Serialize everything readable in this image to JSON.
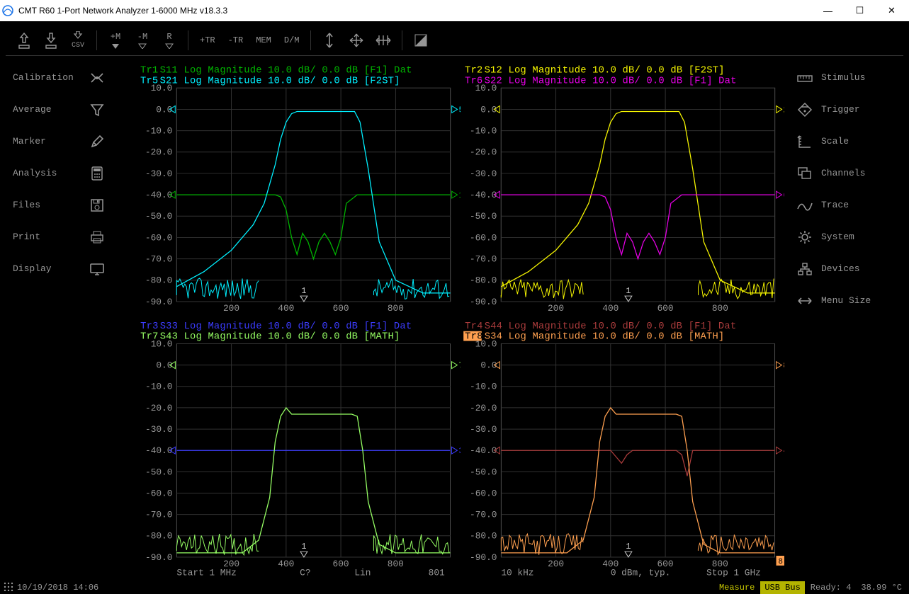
{
  "title": "CMT  R60 1-Port Network Analyzer  1-6000 MHz  v18.3.3",
  "window": {
    "minimize": "—",
    "maximize": "☐",
    "close": "✕"
  },
  "toolbar": {
    "home": "⌂",
    "save": "💾",
    "csv": "CSV",
    "plusM": "+M",
    "minusM": "-M",
    "R": "R",
    "plusTR": "+TR",
    "minusTR": "-TR",
    "MEM": "MEM",
    "DM": "D/M"
  },
  "left_menu": [
    {
      "label": "Calibration",
      "icon": "cal"
    },
    {
      "label": "Average",
      "icon": "funnel"
    },
    {
      "label": "Marker",
      "icon": "pencil"
    },
    {
      "label": "Analysis",
      "icon": "calc"
    },
    {
      "label": "Files",
      "icon": "disk"
    },
    {
      "label": "Print",
      "icon": "printer"
    },
    {
      "label": "Display",
      "icon": "monitor"
    }
  ],
  "right_menu": [
    {
      "label": "Stimulus",
      "icon": "ruler"
    },
    {
      "label": "Trigger",
      "icon": "diamond"
    },
    {
      "label": "Scale",
      "icon": "scale"
    },
    {
      "label": "Channels",
      "icon": "channels"
    },
    {
      "label": "Trace",
      "icon": "trace"
    },
    {
      "label": "System",
      "icon": "gear"
    },
    {
      "label": "Devices",
      "icon": "tree"
    },
    {
      "label": "Menu Size",
      "icon": "resize"
    }
  ],
  "status": {
    "datetime": "10/19/2018 14:06",
    "measure": "Measure",
    "usb": "USB Bus",
    "ready": "Ready: 4",
    "temp": "38.99 °C",
    "start": "Start 1 MHz",
    "c": "C?",
    "lin": "Lin",
    "points": "801",
    "if": "10 kHz",
    "pow": "0 dBm, typ.",
    "stop": "Stop 1 GHz"
  },
  "chart_data": [
    {
      "type": "line",
      "title": "",
      "panel": 1,
      "xlabel": "MHz",
      "ylabel": "dB",
      "ylim": [
        -90,
        10
      ],
      "xlim": [
        0,
        1000
      ],
      "xticks": [
        200,
        400,
        600,
        800
      ],
      "yticks": [
        10,
        0,
        -10,
        -20,
        -30,
        -40,
        -50,
        -60,
        -70,
        -80,
        -90
      ],
      "markers": [
        {
          "id": 1,
          "x": 465
        }
      ],
      "series": [
        {
          "name": "Tr1",
          "label": "Tr1 S11 Log Magnitude 10.0 dB/ 0.0 dB  [F1]   Dat",
          "color": "#00b400",
          "ref": -40,
          "ref_marker": 1,
          "x": [
            0,
            100,
            200,
            280,
            320,
            360,
            380,
            400,
            420,
            440,
            460,
            480,
            500,
            520,
            540,
            560,
            580,
            600,
            620,
            660,
            700,
            800,
            900,
            1000
          ],
          "y": [
            -40,
            -40,
            -40,
            -40,
            -40,
            -40,
            -41,
            -47,
            -60,
            -68,
            -58,
            -62,
            -70,
            -62,
            -58,
            -62,
            -68,
            -60,
            -44,
            -40,
            -40,
            -40,
            -40,
            -40
          ]
        },
        {
          "name": "Tr5",
          "label": "Tr5 S21 Log Magnitude 10.0 dB/ 0.0 dB  [F2ST]",
          "color": "#00f0ff",
          "ref": 0,
          "ref_marker": 5,
          "x": [
            0,
            100,
            200,
            280,
            320,
            360,
            380,
            400,
            420,
            440,
            460,
            650,
            670,
            700,
            740,
            800,
            900,
            1000
          ],
          "y": [
            -83,
            -76,
            -66,
            -54,
            -44,
            -26,
            -14,
            -6,
            -2,
            -1,
            -1,
            -1,
            -6,
            -28,
            -62,
            -80,
            -86,
            -86
          ]
        }
      ]
    },
    {
      "type": "line",
      "panel": 2,
      "xlabel": "MHz",
      "ylabel": "dB",
      "ylim": [
        -90,
        10
      ],
      "xlim": [
        0,
        1000
      ],
      "xticks": [
        200,
        400,
        600,
        800
      ],
      "yticks": [
        10,
        0,
        -10,
        -20,
        -30,
        -40,
        -50,
        -60,
        -70,
        -80,
        -90
      ],
      "markers": [
        {
          "id": 1,
          "x": 465
        }
      ],
      "series": [
        {
          "name": "Tr2",
          "label": "Tr2 S12 Log Magnitude 10.0 dB/ 0.0 dB  [F2ST]",
          "color": "#f5f500",
          "ref": 0,
          "ref_marker": 2,
          "x": [
            0,
            100,
            200,
            280,
            320,
            360,
            380,
            400,
            420,
            440,
            460,
            650,
            670,
            700,
            740,
            800,
            900,
            1000
          ],
          "y": [
            -83,
            -76,
            -66,
            -54,
            -44,
            -26,
            -14,
            -6,
            -2,
            -1,
            -1,
            -1,
            -6,
            -28,
            -62,
            -80,
            -86,
            -86
          ]
        },
        {
          "name": "Tr6",
          "label": "Tr6 S22 Log Magnitude 10.0 dB/ 0.0 dB  [F1]   Dat",
          "color": "#e600e6",
          "ref": -40,
          "ref_marker": 6,
          "x": [
            0,
            100,
            200,
            280,
            320,
            360,
            380,
            400,
            420,
            440,
            460,
            480,
            500,
            520,
            540,
            560,
            580,
            600,
            620,
            660,
            700,
            800,
            900,
            1000
          ],
          "y": [
            -40,
            -40,
            -40,
            -40,
            -40,
            -40,
            -41,
            -47,
            -60,
            -68,
            -58,
            -62,
            -70,
            -62,
            -58,
            -62,
            -68,
            -60,
            -44,
            -40,
            -40,
            -40,
            -40,
            -40
          ]
        }
      ]
    },
    {
      "type": "line",
      "panel": 3,
      "xlabel": "MHz",
      "ylabel": "dB",
      "ylim": [
        -90,
        10
      ],
      "xlim": [
        0,
        1000
      ],
      "xticks": [
        200,
        400,
        600,
        800
      ],
      "yticks": [
        10,
        0,
        -10,
        -20,
        -30,
        -40,
        -50,
        -60,
        -70,
        -80,
        -90
      ],
      "markers": [
        {
          "id": 1,
          "x": 465
        }
      ],
      "series": [
        {
          "name": "Tr3",
          "label": "Tr3 S33 Log Magnitude 10.0 dB/ 0.0 dB  [F1]   Dat",
          "color": "#3c3cff",
          "ref": -40,
          "ref_marker": 3,
          "x": [
            0,
            1000
          ],
          "y": [
            -40,
            -40
          ]
        },
        {
          "name": "Tr7",
          "label": "Tr7 S43 Log Magnitude 10.0 dB/ 0.0 dB  [MATH]",
          "color": "#96ff64",
          "ref": 0,
          "ref_marker": 7,
          "x": [
            0,
            240,
            300,
            340,
            360,
            380,
            400,
            420,
            640,
            660,
            680,
            700,
            740,
            800,
            900,
            1000
          ],
          "y": [
            -88,
            -88,
            -82,
            -62,
            -36,
            -24,
            -20,
            -23,
            -23,
            -24,
            -40,
            -64,
            -84,
            -88,
            -88,
            -88
          ]
        }
      ]
    },
    {
      "type": "line",
      "panel": 4,
      "xlabel": "MHz",
      "ylabel": "dB",
      "ylim": [
        -90,
        10
      ],
      "xlim": [
        0,
        1000
      ],
      "xticks": [
        200,
        400,
        600,
        800
      ],
      "yticks": [
        10,
        0,
        -10,
        -20,
        -30,
        -40,
        -50,
        -60,
        -70,
        -80,
        -90
      ],
      "markers": [
        {
          "id": 1,
          "x": 465
        }
      ],
      "series": [
        {
          "name": "Tr4",
          "label": "Tr4 S44 Log Magnitude 10.0 dB/ 0.0 dB  [F1]   Dat",
          "color": "#aa3c3c",
          "ref": -40,
          "ref_marker": 4,
          "x": [
            0,
            340,
            360,
            380,
            400,
            420,
            440,
            460,
            480,
            640,
            660,
            680,
            700,
            1000
          ],
          "y": [
            -40,
            -40,
            -40,
            -40,
            -40,
            -43,
            -46,
            -42,
            -40,
            -40,
            -42,
            -52,
            -40,
            -40
          ]
        },
        {
          "name": "Tr8",
          "label": "Tr8 S34 Log Magnitude 10.0 dB/ 0.0 dB  [MATH]",
          "color": "#ffa050",
          "ref": 0,
          "ref_marker": 8,
          "active": true,
          "x": [
            0,
            240,
            300,
            340,
            360,
            380,
            400,
            420,
            640,
            660,
            680,
            700,
            740,
            800,
            900,
            1000
          ],
          "y": [
            -88,
            -88,
            -82,
            -62,
            -36,
            -24,
            -20,
            -23,
            -23,
            -24,
            -40,
            -64,
            -84,
            -88,
            -88,
            -88
          ]
        }
      ]
    }
  ]
}
